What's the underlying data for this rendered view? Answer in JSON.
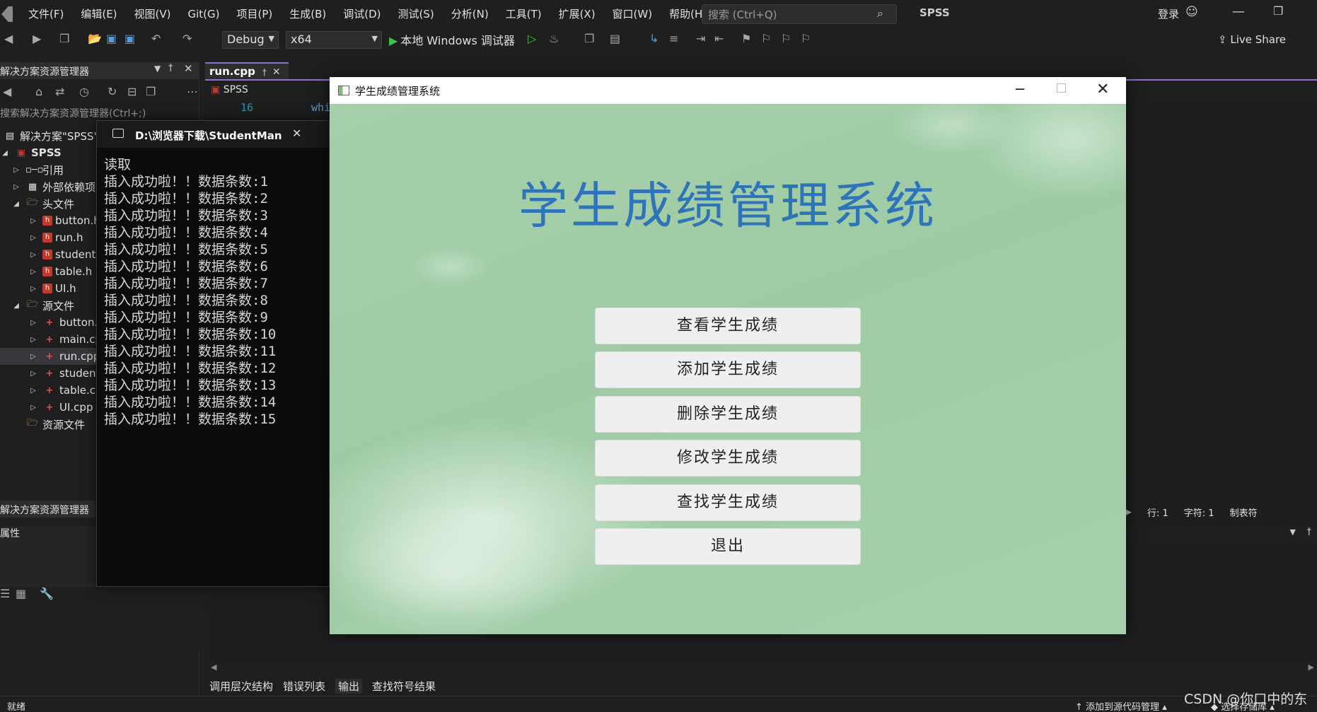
{
  "menubar": {
    "items": [
      "文件(F)",
      "编辑(E)",
      "视图(V)",
      "Git(G)",
      "项目(P)",
      "生成(B)",
      "调试(D)",
      "测试(S)",
      "分析(N)",
      "工具(T)",
      "扩展(X)",
      "窗口(W)",
      "帮助(H)"
    ],
    "search_placeholder": "搜索 (Ctrl+Q)",
    "solution_name": "SPSS",
    "login": "登录"
  },
  "toolbar": {
    "config": "Debug",
    "platform": "x64",
    "run_label": "本地 Windows 调试器",
    "live_share": "Live Share"
  },
  "solution_explorer": {
    "title": "解决方案资源管理器",
    "search_placeholder": "搜索解决方案资源管理器(Ctrl+;)",
    "solution_label": "解决方案\"SPSS\"",
    "project": "SPSS",
    "references": "引用",
    "external": "外部依赖项",
    "headers_folder": "头文件",
    "headers": [
      "button.h",
      "run.h",
      "student.h",
      "table.h",
      "UI.h"
    ],
    "sources_folder": "源文件",
    "sources": [
      "button.cpp",
      "main.cpp",
      "run.cpp",
      "student.cpp",
      "table.cpp",
      "UI.cpp"
    ],
    "resources_folder": "资源文件",
    "tab_label": "解决方案资源管理器",
    "props_title": "属性"
  },
  "editor": {
    "tab": "run.cpp",
    "nav": "SPSS",
    "line_number": "16",
    "code": "whi"
  },
  "status_right": {
    "line": "行: 1",
    "char": "字符: 1",
    "tab": "制表符"
  },
  "bottom_tabs": [
    "调用层次结构",
    "错误列表",
    "输出",
    "查找符号结果"
  ],
  "statusbar": {
    "ready": "就绪",
    "git": "添加到源代码管理",
    "repo": "选择存储库"
  },
  "watermark": "CSDN @你口中的东",
  "console": {
    "title": "D:\\浏览器下载\\StudentMan",
    "lines": [
      "读取",
      "插入成功啦！！数据条数:1",
      "插入成功啦！！数据条数:2",
      "插入成功啦！！数据条数:3",
      "插入成功啦！！数据条数:4",
      "插入成功啦！！数据条数:5",
      "插入成功啦！！数据条数:6",
      "插入成功啦！！数据条数:7",
      "插入成功啦！！数据条数:8",
      "插入成功啦！！数据条数:9",
      "插入成功啦！！数据条数:10",
      "插入成功啦！！数据条数:11",
      "插入成功啦！！数据条数:12",
      "插入成功啦！！数据条数:13",
      "插入成功啦！！数据条数:14",
      "插入成功啦！！数据条数:15"
    ]
  },
  "app": {
    "window_title": "学生成绩管理系统",
    "heading": "学生成绩管理系统",
    "buttons": [
      "查看学生成绩",
      "添加学生成绩",
      "删除学生成绩",
      "修改学生成绩",
      "查找学生成绩",
      "退出"
    ],
    "accent_color": "#2e74b8",
    "background_color": "#a5cfa9"
  }
}
